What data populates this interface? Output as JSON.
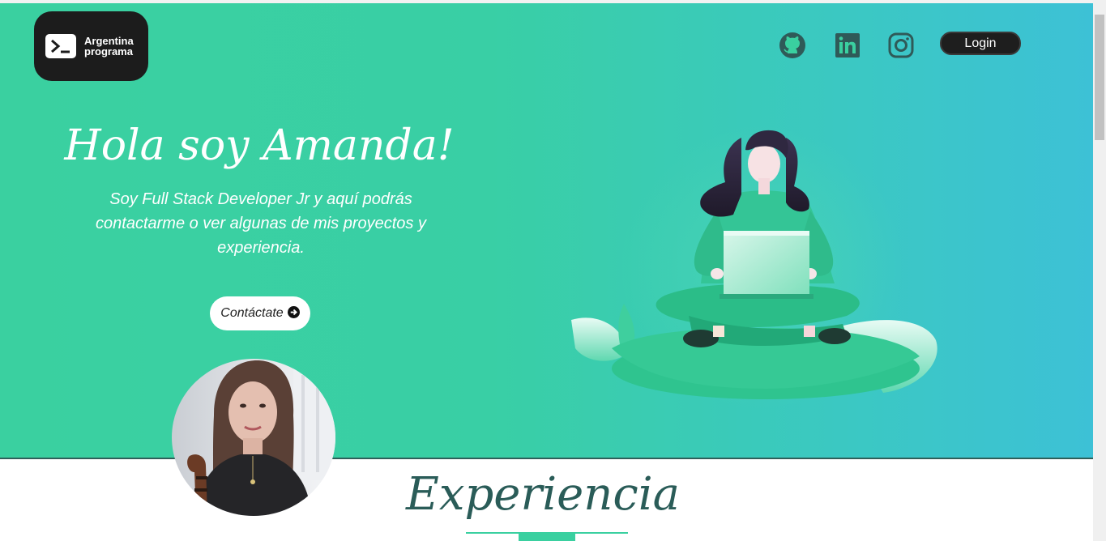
{
  "header": {
    "logo_line1": "Argentina",
    "logo_line2": "programa",
    "login_label": "Login",
    "social_icons": [
      "github-icon",
      "linkedin-icon",
      "instagram-icon"
    ]
  },
  "hero": {
    "title": "Hola soy Amanda!",
    "subtitle": "Soy Full Stack Developer Jr y aquí podrás contactarme o ver algunas de mis proyectos y experiencia.",
    "contact_label": "Contáctate"
  },
  "section": {
    "title": "Experiencia"
  },
  "colors": {
    "hero_start": "#3ad0a0",
    "hero_end": "#3dc1d6",
    "accent_dark": "#2a5c58",
    "button_dark": "#1e1e1e"
  }
}
